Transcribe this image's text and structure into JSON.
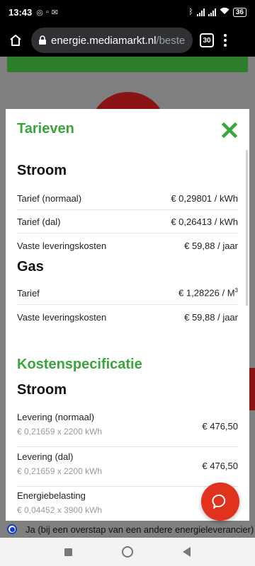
{
  "status_bar": {
    "time": "13:43",
    "battery": "36"
  },
  "browser": {
    "url_domain": "energie.mediamarkt.nl",
    "url_path": "/beste",
    "tab_count": "30"
  },
  "modal": {
    "title": "Tarieven",
    "stroom_heading": "Stroom",
    "stroom_rows": [
      {
        "label": "Tarief (normaal)",
        "value": "€ 0,29801 / kWh"
      },
      {
        "label": "Tarief (dal)",
        "value": "€ 0,26413 / kWh"
      },
      {
        "label": "Vaste leveringskosten",
        "value": "€ 59,88 / jaar"
      }
    ],
    "gas_heading": "Gas",
    "gas_rows": [
      {
        "label": "Tarief",
        "value": "€ 1,28226 / M",
        "sup": "3"
      },
      {
        "label": "Vaste leveringskosten",
        "value": "€ 59,88 / jaar"
      }
    ],
    "kosten_heading": "Kostenspecificatie",
    "kosten_stroom_heading": "Stroom",
    "kosten_rows": [
      {
        "label": "Levering (normaal)",
        "calc": "€ 0,21659 x 2200 kWh",
        "amount": "€ 476,50"
      },
      {
        "label": "Levering (dal)",
        "calc": "€ 0,21659 x 2200 kWh",
        "amount": "€ 476,50"
      },
      {
        "label": "Energiebelasting",
        "calc": "€ 0,04452 x 3900 kWh",
        "amount": ""
      }
    ]
  },
  "background": {
    "radio_label": "Ja (bij een overstap van een andere energieleverancier)"
  },
  "colors": {
    "accent_green": "#3aa53a",
    "chat_red": "#e0321d",
    "radio_blue": "#1a3fc4"
  }
}
